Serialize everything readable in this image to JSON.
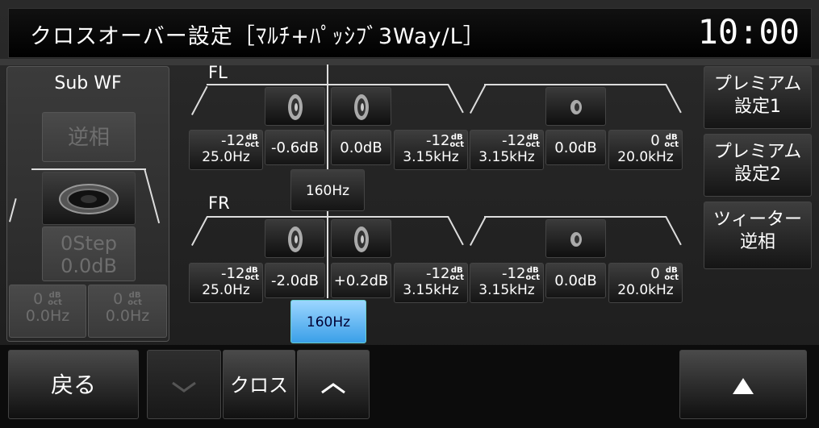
{
  "header": {
    "title": "クロスオーバー設定［ﾏﾙﾁ+ﾊﾟｯｼﾌﾞ3Way/L］",
    "clock": "10:00"
  },
  "subwf": {
    "title": "Sub WF",
    "phase_label": "逆相",
    "step_line1": "0Step",
    "step_line2": "0.0dB",
    "slope_left": "0",
    "freq_left": "0.0Hz",
    "slope_right": "0",
    "freq_right": "0.0Hz"
  },
  "units": {
    "db": "dB",
    "oct": "oct"
  },
  "fl": {
    "label": "FL",
    "low_slope": "-12",
    "low_freq": "25.0Hz",
    "gain_woofer": "-0.6dB",
    "gain_mid": "0.0dB",
    "mid_hi_slope": "-12",
    "mid_hi_freq": "3.15kHz",
    "tw_lo_slope": "-12",
    "tw_lo_freq": "3.15kHz",
    "gain_tweeter": "0.0dB",
    "tw_hi_slope": "0",
    "tw_hi_freq": "20.0kHz",
    "crossover": "160Hz"
  },
  "fr": {
    "label": "FR",
    "low_slope": "-12",
    "low_freq": "25.0Hz",
    "gain_woofer": "-2.0dB",
    "gain_mid": "+0.2dB",
    "mid_hi_slope": "-12",
    "mid_hi_freq": "3.15kHz",
    "tw_lo_slope": "-12",
    "tw_lo_freq": "3.15kHz",
    "gain_tweeter": "0.0dB",
    "tw_hi_slope": "0",
    "tw_hi_freq": "20.0kHz",
    "crossover": "160Hz"
  },
  "right": {
    "premium1_line1": "プレミアム",
    "premium1_line2": "設定1",
    "premium2_line1": "プレミアム",
    "premium2_line2": "設定2",
    "tweeter_line1": "ツィーター",
    "tweeter_line2": "逆相"
  },
  "bottom": {
    "back": "戻る",
    "mode": "クロス",
    "down_icon": "chevron-down-icon",
    "up_icon": "chevron-up-icon",
    "eject_icon": "triangle-up-icon"
  },
  "colors": {
    "selected": "#3a9fe8",
    "text": "#ffffff",
    "dim_text": "#6e6e6e"
  }
}
